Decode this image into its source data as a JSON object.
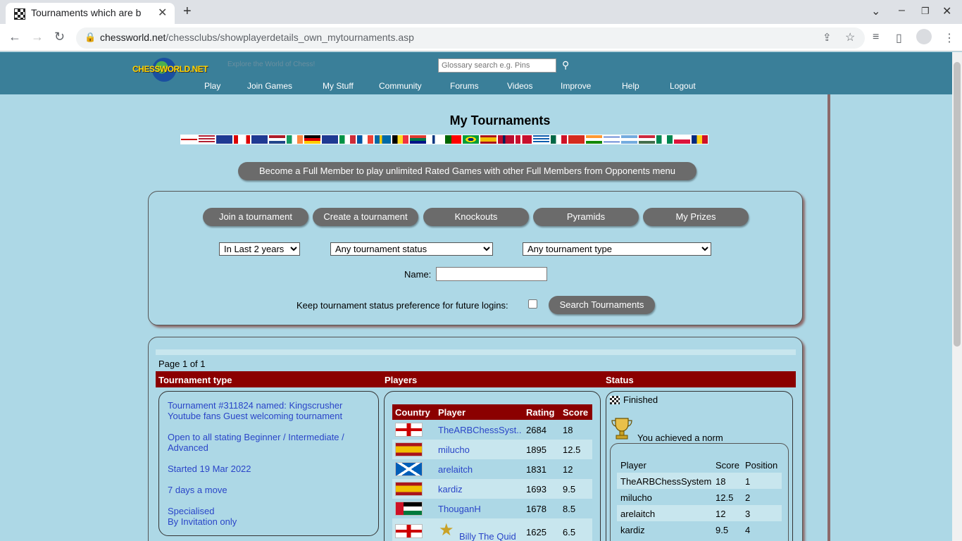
{
  "browser": {
    "tab_title": "Tournaments which are b",
    "url_domain": "chessworld.net",
    "url_path": "/chessclubs/showplayerdetails_own_mytournaments.asp",
    "icons": [
      "back-icon",
      "forward-icon",
      "reload-icon",
      "lock-icon",
      "share-icon",
      "star-icon",
      "media-icon",
      "sidepanel-icon",
      "profile-icon",
      "menu-icon"
    ]
  },
  "site": {
    "logo_text": "CHESSWORLD.NET",
    "tagline": "Explore the World of Chess!",
    "glossary_placeholder": "Glossary search e.g. Pins",
    "nav": [
      "Play",
      "Join Games",
      "My Stuff",
      "Community",
      "Forums",
      "Videos",
      "Improve",
      "Help",
      "Logout"
    ]
  },
  "page": {
    "title": "My Tournaments",
    "member_button": "Become a Full Member to play unlimited Rated Games with other Full Members from Opponents menu",
    "actions": [
      "Join a tournament",
      "Create a tournament",
      "Knockouts",
      "Pyramids",
      "My Prizes"
    ],
    "filters": {
      "period": "In Last 2 years",
      "status": "Any tournament status",
      "type": "Any tournament type",
      "name_label": "Name:",
      "name_value": "",
      "keep_label": "Keep tournament status preference for future logins:",
      "keep_checked": false,
      "search_button": "Search Tournaments"
    }
  },
  "results": {
    "page_info": "Page 1 of 1",
    "columns": [
      "Tournament type",
      "Players",
      "Status"
    ],
    "tournament": {
      "name_line1": "Tournament #311824 named: Kingscrusher",
      "name_line2": "Youtube fans Guest welcoming tournament",
      "open_line1": "Open to all stating Beginner / Intermediate /",
      "open_line2": "Advanced",
      "started": "Started 19 Mar 2022",
      "speed": "7 days a move",
      "specialised": "Specialised",
      "invitation": "By Invitation only"
    },
    "players_header": [
      "Country",
      "Player",
      "Rating",
      "Score"
    ],
    "players": [
      {
        "country": "England",
        "name": "TheARBChessSyst..",
        "rating": "2684",
        "score": "18"
      },
      {
        "country": "Spain",
        "name": "milucho",
        "rating": "1895",
        "score": "12.5"
      },
      {
        "country": "Scotland",
        "name": "arelaitch",
        "rating": "1831",
        "score": "12"
      },
      {
        "country": "Spain",
        "name": "kardiz",
        "rating": "1693",
        "score": "9.5"
      },
      {
        "country": "Jordan",
        "name": "ThouganH",
        "rating": "1678",
        "score": "8.5"
      },
      {
        "country": "England",
        "name": "Billy The Quid",
        "rating": "1625",
        "score": "6.5"
      }
    ],
    "status": {
      "state": "Finished",
      "norm_text": "You achieved a norm",
      "table_header": [
        "Player",
        "Score",
        "Position"
      ],
      "rows": [
        {
          "player": "TheARBChessSystem",
          "score": "18",
          "position": "1"
        },
        {
          "player": "milucho",
          "score": "12.5",
          "position": "2"
        },
        {
          "player": "arelaitch",
          "score": "12",
          "position": "3"
        },
        {
          "player": "kardiz",
          "score": "9.5",
          "position": "4"
        }
      ]
    }
  },
  "colors": {
    "header_bg": "#3a7f99",
    "page_bg": "#add8e6",
    "table_header_bg": "#8b0000",
    "link": "#2a45c8",
    "button_bg": "#6b6b6b"
  }
}
